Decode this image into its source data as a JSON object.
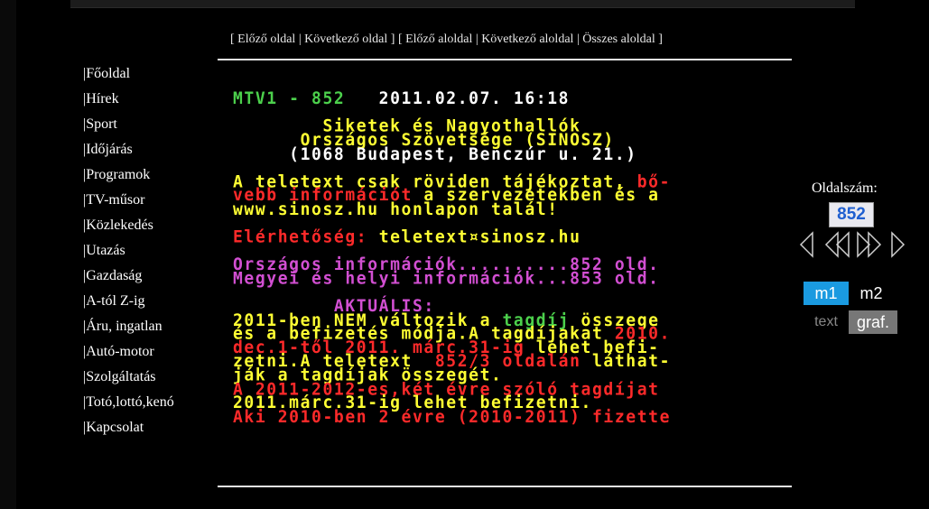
{
  "nav": {
    "prev_page": "Előző oldal",
    "next_page": "Következő oldal",
    "prev_sub": "Előző aloldal",
    "next_sub": "Következő aloldal",
    "all_sub": "Összes aloldal"
  },
  "sidebar": {
    "items": [
      {
        "label": "|Főoldal"
      },
      {
        "label": "|Hírek"
      },
      {
        "label": "|Sport"
      },
      {
        "label": "|Időjárás"
      },
      {
        "label": "|Programok"
      },
      {
        "label": "|TV-műsor"
      },
      {
        "label": "|Közlekedés"
      },
      {
        "label": "|Utazás"
      },
      {
        "label": "|Gazdaság"
      },
      {
        "label": "|A-tól Z-ig"
      },
      {
        "label": "|Áru, ingatlan"
      },
      {
        "label": "|Autó-motor"
      },
      {
        "label": "|Szolgáltatás"
      },
      {
        "label": "|Totó,lottó,kenó"
      },
      {
        "label": "|Kapcsolat"
      }
    ]
  },
  "teletext": {
    "header_channel": "MTV1 - 852",
    "header_datetime": "   2011.02.07. 16:18",
    "lines": [
      [
        {
          "t": "        Siketek és Nagyothallók",
          "c": "y"
        }
      ],
      [
        {
          "t": "      Országos Szövetsége (SINOSZ)",
          "c": "y"
        }
      ],
      [
        {
          "t": "     (1068 Budapest, Benczúr u. 21.)",
          "c": "w"
        }
      ],
      [
        {
          "t": "",
          "c": "w"
        }
      ],
      [
        {
          "t": "A teletext csak röviden tájékoztat, ",
          "c": "y"
        },
        {
          "t": "bő-",
          "c": "r"
        }
      ],
      [
        {
          "t": "vebb információt",
          "c": "r"
        },
        {
          "t": " a szervezetekben és a",
          "c": "y"
        }
      ],
      [
        {
          "t": "www.sinosz.hu honlapon talál!",
          "c": "y"
        }
      ],
      [
        {
          "t": "",
          "c": "w"
        }
      ],
      [
        {
          "t": "Elérhetőség: ",
          "c": "r"
        },
        {
          "t": "teletext¤sinosz.hu",
          "c": "y"
        }
      ],
      [
        {
          "t": "",
          "c": "w"
        }
      ],
      [
        {
          "t": "Országos információk..........852 old.",
          "c": "m"
        }
      ],
      [
        {
          "t": "Megyei és helyi információk...853 old.",
          "c": "m"
        }
      ],
      [
        {
          "t": "",
          "c": "w"
        }
      ],
      [
        {
          "t": "         AKTUÁLIS:",
          "c": "m"
        }
      ],
      [
        {
          "t": "2011-ben NEM változik a ",
          "c": "y"
        },
        {
          "t": "tagdíj",
          "c": "g"
        },
        {
          "t": " összege",
          "c": "y"
        }
      ],
      [
        {
          "t": "és a befizetés módja.A tagdíjakat ",
          "c": "y"
        },
        {
          "t": "2010.",
          "c": "r"
        }
      ],
      [
        {
          "t": "dec.1-től 2011. márc.31-ig",
          "c": "r"
        },
        {
          "t": " lehet befi-",
          "c": "y"
        }
      ],
      [
        {
          "t": "zetni.A teletext ",
          "c": "y"
        },
        {
          "t": " 852/3 oldalán",
          "c": "r"
        },
        {
          "t": " láthat-",
          "c": "y"
        }
      ],
      [
        {
          "t": "ják a tagdíjak összegét.",
          "c": "y"
        }
      ],
      [
        {
          "t": "A 2011-2012-es,két évre szóló tagdíjat",
          "c": "r"
        }
      ],
      [
        {
          "t": "2011.márc.31-ig lehet befizetni.",
          "c": "y"
        }
      ],
      [
        {
          "t": "Aki 2010-ben 2 évre (2010-2011) fizette",
          "c": "r"
        }
      ]
    ]
  },
  "right": {
    "page_label": "Oldalszám:",
    "page_value": "852",
    "mode_m1": "m1",
    "mode_m2": "m2",
    "mode_text": "text",
    "mode_graf": "graf."
  },
  "colors": {
    "accent": "#1a9ae0",
    "yellow": "#ffff33",
    "red": "#ff2a2a",
    "magenta": "#d24fd2",
    "green": "#4cd04c"
  }
}
